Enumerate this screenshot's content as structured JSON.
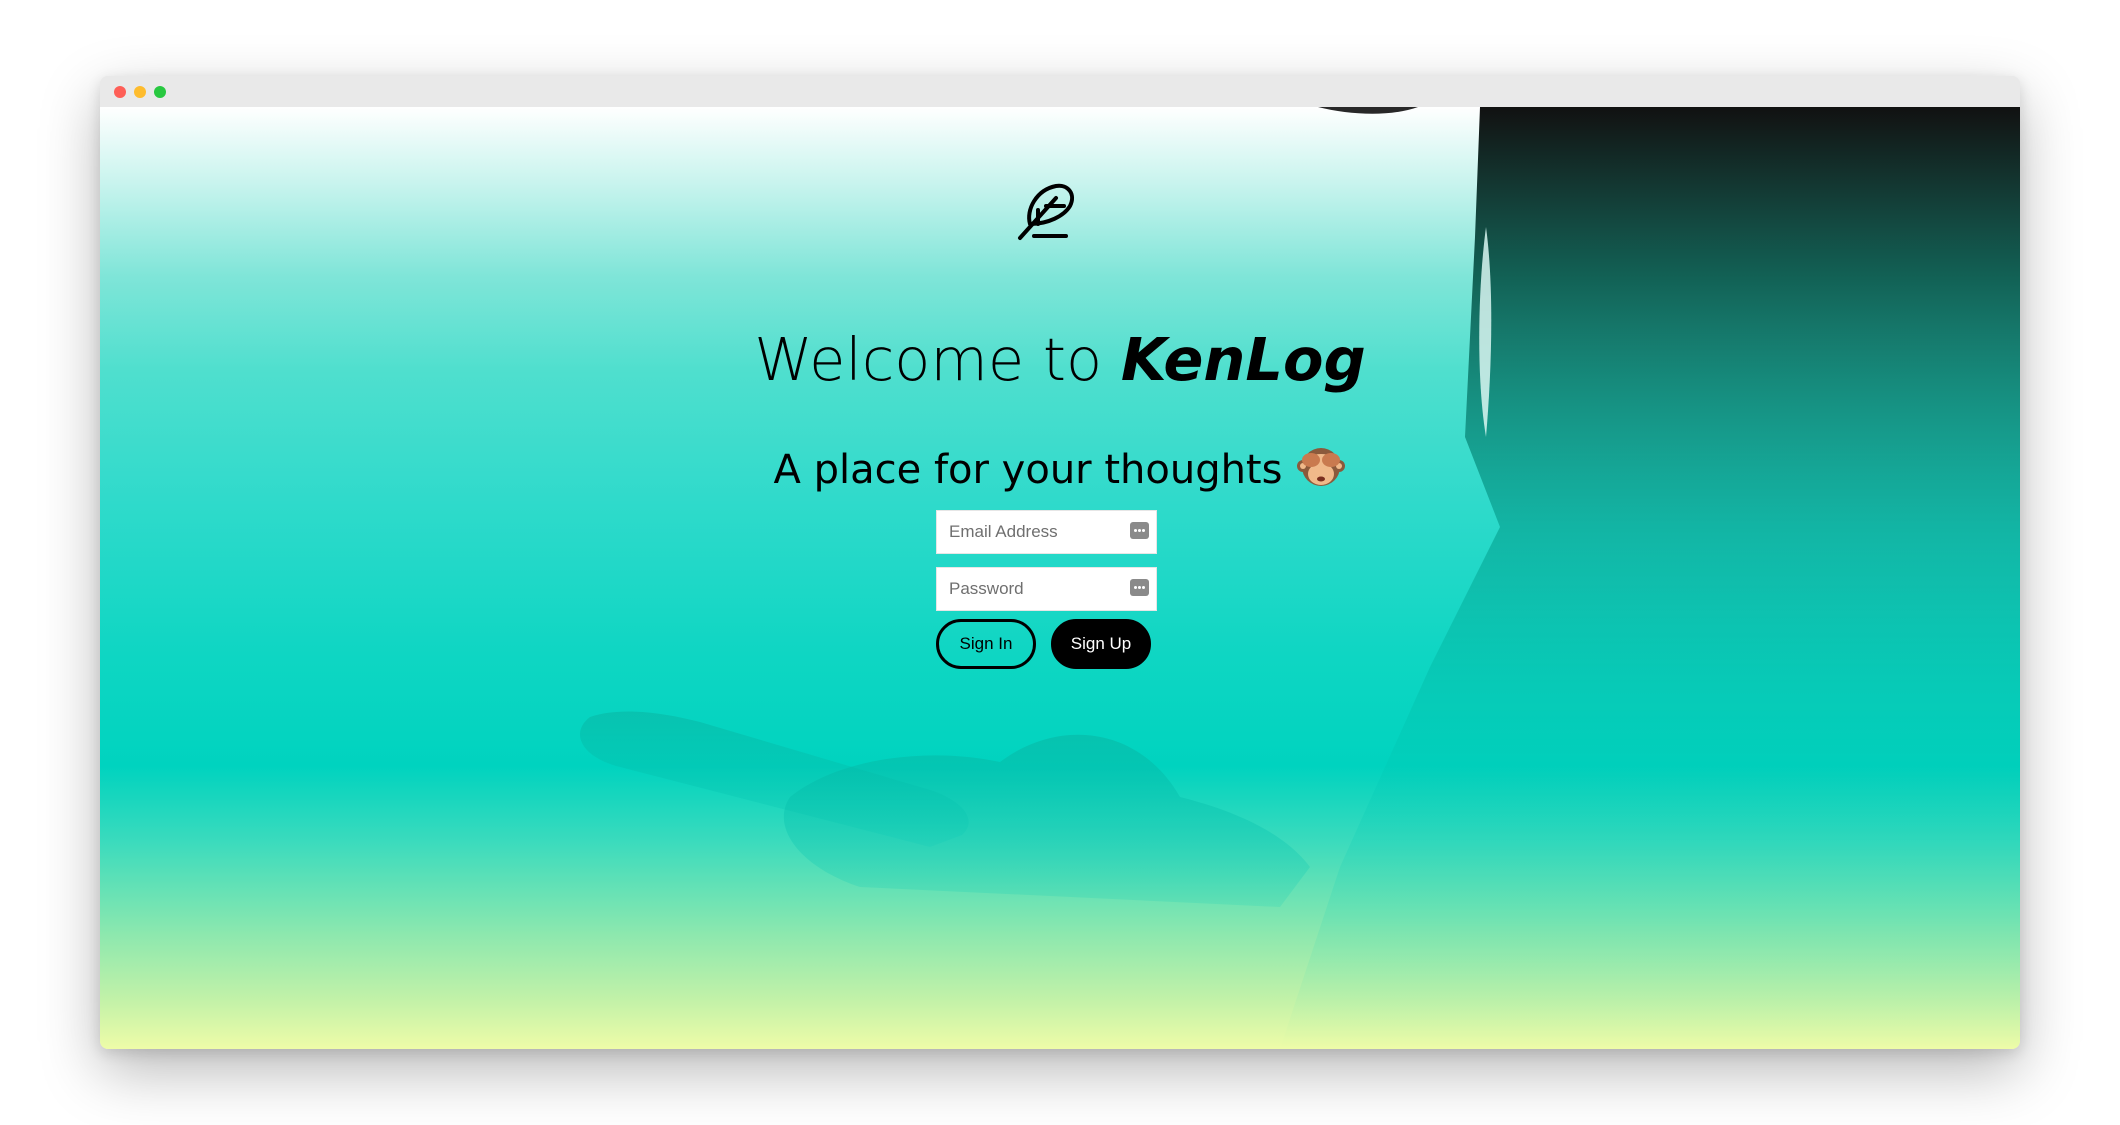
{
  "window": {
    "traffic_lights": [
      "close",
      "minimize",
      "zoom"
    ]
  },
  "page": {
    "logo_icon": "feather-pen-icon",
    "title_prefix": "Welcome to ",
    "title_brand": "KenLog",
    "subtitle": "A place for your thoughts",
    "subtitle_emoji_icon": "see-no-evil-monkey-icon"
  },
  "form": {
    "email": {
      "placeholder": "Email Address",
      "value": ""
    },
    "password": {
      "placeholder": "Password",
      "value": ""
    },
    "field_icon": "password-manager-key-icon",
    "sign_in_label": "Sign In",
    "sign_up_label": "Sign Up"
  },
  "colors": {
    "teal": "#00d3bf",
    "light_yellow": "#eefca8",
    "black": "#000000"
  }
}
